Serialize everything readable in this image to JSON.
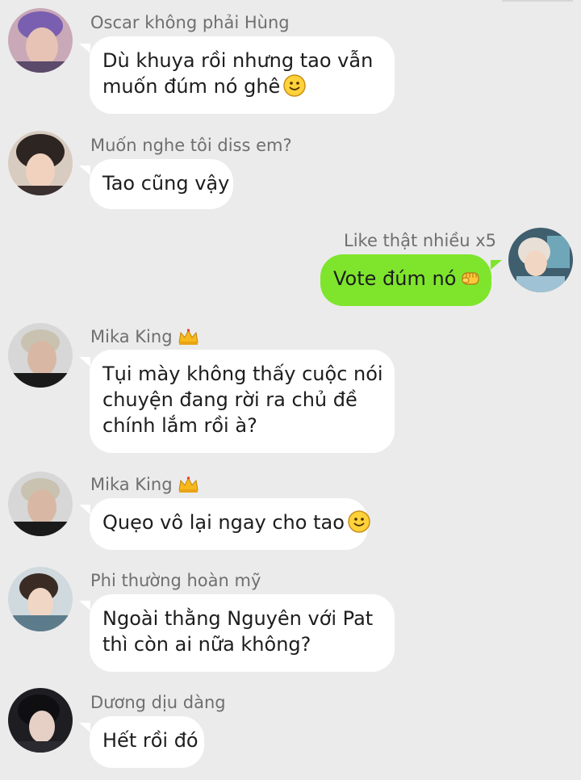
{
  "messages": [
    {
      "sender": "Oscar không phải Hùng",
      "lines": [
        "Dù khuya rồi nhưng tao vẫn",
        "muốn đúm nó ghê"
      ],
      "emoji": "smile-emoji"
    },
    {
      "sender": "Muốn nghe tôi diss em?",
      "lines": [
        "Tao cũng vậy"
      ]
    },
    {
      "sender": "Like thật nhiều x5",
      "lines": [
        "Vote đúm nó"
      ],
      "emoji": "fist-emoji",
      "mine": true
    },
    {
      "sender": "Mika King",
      "badge": "crown-icon",
      "lines": [
        "Tụi mày không thấy cuộc nói",
        "chuyện đang rời ra chủ đề",
        "chính lắm rồi à?"
      ]
    },
    {
      "sender": "Mika King",
      "badge": "crown-icon",
      "lines": [
        "Quẹo vô lại ngay cho tao"
      ],
      "emoji": "smile-emoji"
    },
    {
      "sender": "Phi thường hoàn mỹ",
      "lines": [
        "Ngoài thằng Nguyên với Pat",
        "thì còn ai nữa không?"
      ]
    },
    {
      "sender": "Dương dịu dàng",
      "lines": [
        "Hết rồi đó"
      ]
    }
  ],
  "colors": {
    "background": "#ebebeb",
    "bubble_incoming": "#ffffff",
    "bubble_outgoing": "#7ee52c",
    "sender_name": "#6f6f6f",
    "message_text": "#1d1d1d"
  }
}
